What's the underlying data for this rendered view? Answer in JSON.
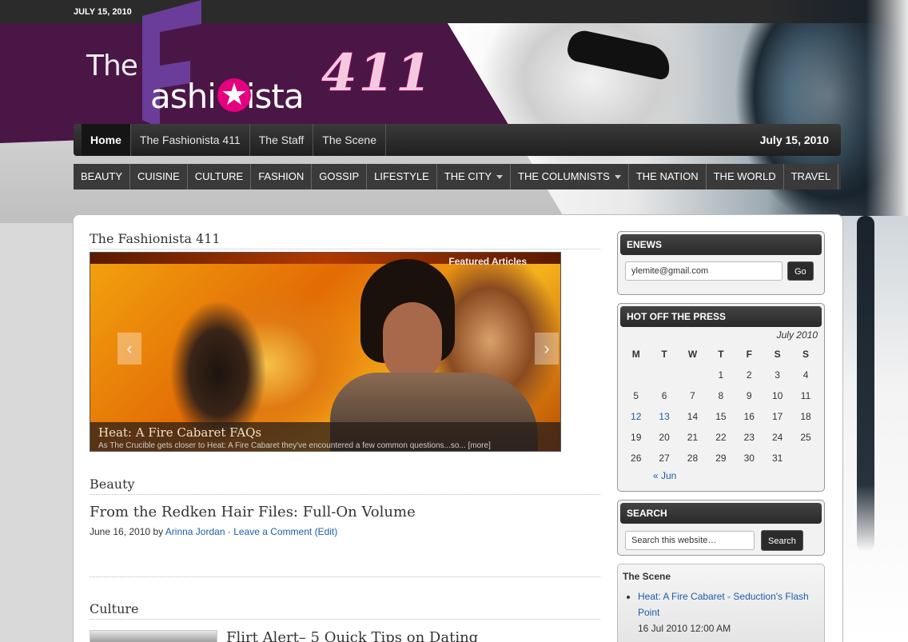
{
  "topbar": {
    "date": "JULY 15, 2010"
  },
  "logo": {
    "the": "The",
    "f_letter": "F",
    "word": "ashi   nista",
    "number": "411"
  },
  "primary_nav": {
    "items": [
      "Home",
      "The Fashionista 411",
      "The Staff",
      "The Scene"
    ],
    "active": "Home",
    "date": "July 15, 2010"
  },
  "category_nav": {
    "items": [
      {
        "label": "BEAUTY",
        "has_dropdown": false
      },
      {
        "label": "CUISINE",
        "has_dropdown": false
      },
      {
        "label": "CULTURE",
        "has_dropdown": false
      },
      {
        "label": "FASHION",
        "has_dropdown": false
      },
      {
        "label": "GOSSIP",
        "has_dropdown": false
      },
      {
        "label": "LIFESTYLE",
        "has_dropdown": false
      },
      {
        "label": "THE CITY",
        "has_dropdown": true
      },
      {
        "label": "THE COLUMNISTS",
        "has_dropdown": true
      },
      {
        "label": "THE NATION",
        "has_dropdown": false
      },
      {
        "label": "THE WORLD",
        "has_dropdown": false
      },
      {
        "label": "TRAVEL",
        "has_dropdown": false
      }
    ]
  },
  "main": {
    "section_title": "The Fashionista 411",
    "featured": {
      "label": "Featured Articles",
      "caption_title": "Heat: A Fire Cabaret FAQs",
      "caption_text": "As The Crucible gets closer to Heat: A Fire Cabaret they've encountered a few common questions...so... [more]"
    },
    "beauty": {
      "heading": "Beauty",
      "post_title": "From the Redken Hair Files: Full-On Volume",
      "date": "June 16, 2010",
      "by": "by",
      "author": "Arinna Jordan",
      "comment": "Leave a Comment",
      "edit": "(Edit)"
    },
    "culture": {
      "heading": "Culture",
      "post_title": "Flirt Alert– 5 Quick Tips on Dating"
    }
  },
  "sidebar": {
    "enews": {
      "title": "ENEWS",
      "email_value": "ylemite@gmail.com",
      "go_label": "Go"
    },
    "calendar": {
      "title": "HOT OFF THE PRESS",
      "caption": "July 2010",
      "weekdays": [
        "M",
        "T",
        "W",
        "T",
        "F",
        "S",
        "S"
      ],
      "weeks": [
        [
          "",
          "",
          "",
          "1",
          "2",
          "3",
          "4"
        ],
        [
          "5",
          "6",
          "7",
          "8",
          "9",
          "10",
          "11"
        ],
        [
          "12",
          "13",
          "14",
          "15",
          "16",
          "17",
          "18"
        ],
        [
          "19",
          "20",
          "21",
          "22",
          "23",
          "24",
          "25"
        ],
        [
          "26",
          "27",
          "28",
          "29",
          "30",
          "31",
          ""
        ]
      ],
      "linked_days": [
        "12",
        "13"
      ],
      "prev_label": "« Jun"
    },
    "search": {
      "title": "SEARCH",
      "placeholder": "Search this website…",
      "button": "Search"
    },
    "scene": {
      "title": "The Scene",
      "items": [
        {
          "link": "Heat: A Fire Cabaret - Seduction's Flash Point",
          "date": "16 Jul 2010 12:00 AM"
        }
      ]
    }
  },
  "colors": {
    "header_purple": "#4a1646",
    "nav_dark": "#2b2b2b",
    "link_blue": "#1d5ea8",
    "logo_pink": "#e6007e",
    "logo_f_purple": "#6a3d9a"
  }
}
